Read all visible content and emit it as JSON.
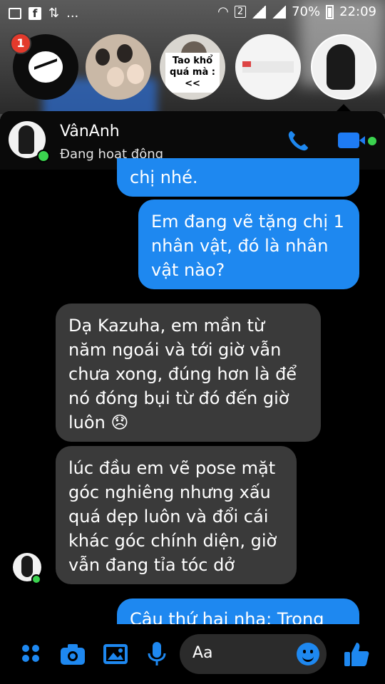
{
  "status_bar": {
    "dots": "...",
    "sim_label": "2",
    "battery": "70%",
    "time": "22:09"
  },
  "chat_heads": {
    "badge_count": "1",
    "caption_head": "Tao khổ quá mà :<<"
  },
  "contact": {
    "name": "VânAnh",
    "status": "Đang hoạt động"
  },
  "messages": [
    {
      "side": "out",
      "text": "chị nhé."
    },
    {
      "side": "out",
      "text": "Em đang vẽ tặng chị 1\nnhân vật, đó là nhân\nvật nào?"
    },
    {
      "side": "in",
      "text": "Dạ Kazuha, em mần từ\nnăm ngoái và tới giờ vẫn\nchưa xong, đúng hơn là để\nnó đóng bụi từ đó đến giờ\nluôn 😞"
    },
    {
      "side": "in",
      "text": "lúc đầu em vẽ pose mặt\ngóc nghiêng nhưng xấu\nquá dẹp luôn và đổi cái\nkhác góc chính diện, giờ\nvẫn đang tỉa tóc dở"
    },
    {
      "side": "out",
      "text": "Câu thứ hai nha: Trong"
    }
  ],
  "composer": {
    "placeholder": "Aa"
  },
  "colors": {
    "accent": "#1e88f0",
    "incoming": "#3a3a3a",
    "online": "#3bd34f"
  }
}
